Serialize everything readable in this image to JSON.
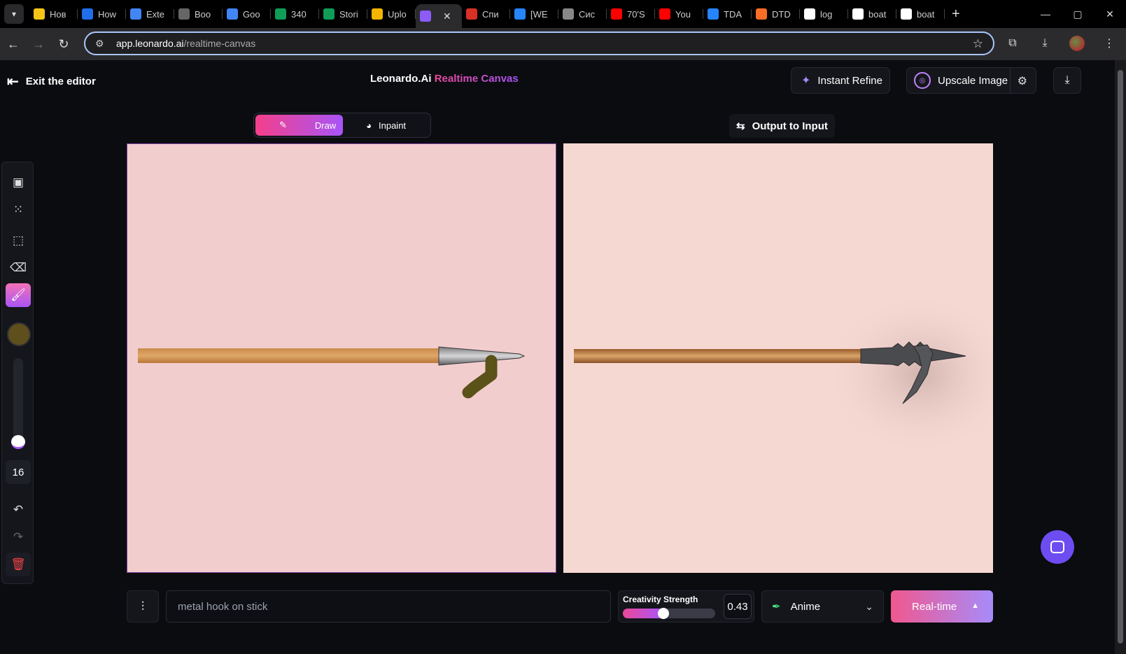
{
  "browser": {
    "tabs": [
      {
        "label": "Нов",
        "favicon": "smiley-icon",
        "color": "#f5c518"
      },
      {
        "label": "How",
        "favicon": "browser-icon",
        "color": "#1f6feb"
      },
      {
        "label": "Exte",
        "favicon": "puzzle-icon",
        "color": "#4285f4"
      },
      {
        "label": "Boo",
        "favicon": "openai-icon",
        "color": "#666666"
      },
      {
        "label": "Goo",
        "favicon": "translate-icon",
        "color": "#4285f4"
      },
      {
        "label": "340",
        "favicon": "sheets-icon",
        "color": "#0f9d58"
      },
      {
        "label": "Stori",
        "favicon": "plus-circle-icon",
        "color": "#0f9d58"
      },
      {
        "label": "Uplo",
        "favicon": "slides-icon",
        "color": "#f4b400"
      },
      {
        "label": "",
        "favicon": "leonardo-icon",
        "color": "#8b5cf6",
        "active": true
      },
      {
        "label": "Спи",
        "favicon": "doc-icon",
        "color": "#d93025"
      },
      {
        "label": "[WE",
        "favicon": "diamond-icon",
        "color": "#2684ff"
      },
      {
        "label": "Сис",
        "favicon": "globe-icon",
        "color": "#888888"
      },
      {
        "label": "70'S",
        "favicon": "youtube-icon",
        "color": "#ff0000"
      },
      {
        "label": "You",
        "favicon": "youtube-icon",
        "color": "#ff0000"
      },
      {
        "label": "TDA",
        "favicon": "diamond-icon",
        "color": "#2684ff"
      },
      {
        "label": "DTD",
        "favicon": "gitlab-icon",
        "color": "#fc6d26"
      },
      {
        "label": "log",
        "favicon": "google-icon",
        "color": "#ffffff"
      },
      {
        "label": "boat",
        "favicon": "google-icon",
        "color": "#ffffff"
      },
      {
        "label": "boat",
        "favicon": "google-icon",
        "color": "#ffffff"
      }
    ],
    "url_host": "app.leonardo.ai",
    "url_path": "/realtime-canvas"
  },
  "header": {
    "exit_label": "Exit the editor",
    "title_main": "Leonardo.Ai",
    "title_accent": "Realtime Canvas",
    "instant_refine": "Instant Refine",
    "upscale_image": "Upscale Image"
  },
  "modes": {
    "draw": "Draw",
    "inpaint": "Inpaint"
  },
  "output_to_input": "Output to Input",
  "toolbar": {
    "brush_color": "#5e4f1c",
    "brush_size": "16",
    "brush_size_level": 0.0
  },
  "bottom": {
    "prompt_placeholder": "metal hook on stick",
    "creativity_label": "Creativity Strength",
    "creativity_value": "0.43",
    "creativity_fraction": 0.43,
    "style": "Anime",
    "mode_button": "Real-time"
  },
  "colors": {
    "accent_pink": "#ec4899",
    "accent_purple": "#a855f7",
    "left_canvas_bg": "#f2cdcd",
    "right_canvas_bg": "#f6d8d3"
  }
}
